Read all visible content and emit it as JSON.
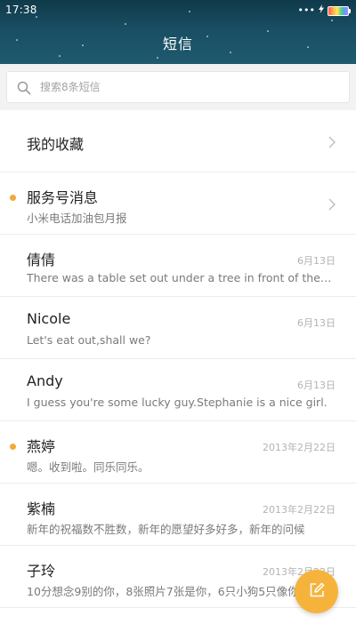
{
  "status_bar": {
    "time": "17:38",
    "signal_dots": "•••",
    "charging_icon": "lightning-bolt-icon"
  },
  "header": {
    "title": "短信"
  },
  "search": {
    "placeholder": "搜索8条短信",
    "icon": "search-icon"
  },
  "colors": {
    "header_bg": "#194e63",
    "unread_dot": "#f2a93b",
    "fab": "#f6b33c",
    "divider": "#ececec",
    "date_text": "#b3b3b3"
  },
  "list": {
    "items": [
      {
        "title": "我的收藏",
        "type": "folder",
        "chevron": true
      },
      {
        "title": "服务号消息",
        "subtitle": "小米电话加油包月报",
        "type": "folder",
        "unread": true,
        "chevron": true
      },
      {
        "title": "倩倩",
        "subtitle": "There was a table set out under a tree in front of the house",
        "date": "6月13日"
      },
      {
        "title": "Nicole",
        "subtitle": "Let's eat out,shall we?",
        "date": "6月13日"
      },
      {
        "title": "Andy",
        "subtitle": "I guess you're some lucky guy.Stephanie is a nice girl.",
        "date": "6月13日"
      },
      {
        "title": "燕婷",
        "subtitle": "嗯。收到啦。同乐同乐。",
        "date": "2013年2月22日",
        "unread": true
      },
      {
        "title": "紫楠",
        "subtitle": "新年的祝福数不胜数，新年的愿望好多好多，新年的问候",
        "date": "2013年2月22日"
      },
      {
        "title": "子玲",
        "subtitle": "10分想念9别的你，8张照片7张是你，6只小狗5只像你",
        "date": "2013年2月22日"
      }
    ]
  },
  "fab": {
    "icon": "compose-icon"
  }
}
